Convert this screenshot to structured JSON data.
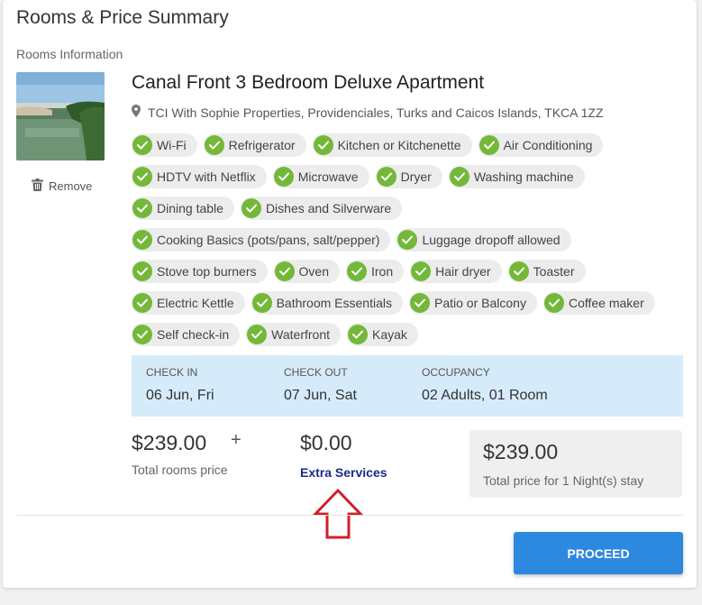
{
  "header": {
    "title": "Rooms & Price Summary"
  },
  "rooms_info_label": "Rooms Information",
  "room": {
    "name": "Canal Front 3 Bedroom Deluxe Apartment",
    "location": "TCI With Sophie Properties, Providenciales, Turks and Caicos Islands, TKCA 1ZZ",
    "remove_label": "Remove"
  },
  "amenities": [
    [
      "Wi-Fi",
      "Refrigerator",
      "Kitchen or Kitchenette",
      "Air Conditioning"
    ],
    [
      "HDTV with Netflix",
      "Microwave",
      "Dryer",
      "Washing machine"
    ],
    [
      "Dining table",
      "Dishes and Silverware"
    ],
    [
      "Cooking Basics (pots/pans, salt/pepper)",
      "Luggage dropoff allowed"
    ],
    [
      "Stove top burners",
      "Oven",
      "Iron",
      "Hair dryer",
      "Toaster"
    ],
    [
      "Electric Kettle",
      "Bathroom Essentials",
      "Patio or Balcony",
      "Coffee maker"
    ],
    [
      "Self check-in",
      "Waterfront",
      "Kayak"
    ]
  ],
  "booking": {
    "check_in_label": "CHECK IN",
    "check_in_value": "06 Jun, Fri",
    "check_out_label": "CHECK OUT",
    "check_out_value": "07 Jun, Sat",
    "occupancy_label": "OCCUPANCY",
    "occupancy_value": "02 Adults, 01 Room"
  },
  "pricing": {
    "rooms_price": "$239.00",
    "rooms_price_label": "Total rooms price",
    "plus": "+",
    "extra_price": "$0.00",
    "extra_label": "Extra Services",
    "total_price": "$239.00",
    "total_label": "Total price for 1 Night(s) stay"
  },
  "proceed_label": "PROCEED",
  "colors": {
    "accent": "#2d88e0",
    "check_green": "#74b83a",
    "booking_bg": "#d6ebfa",
    "annotation_arrow": "#d0202a"
  }
}
